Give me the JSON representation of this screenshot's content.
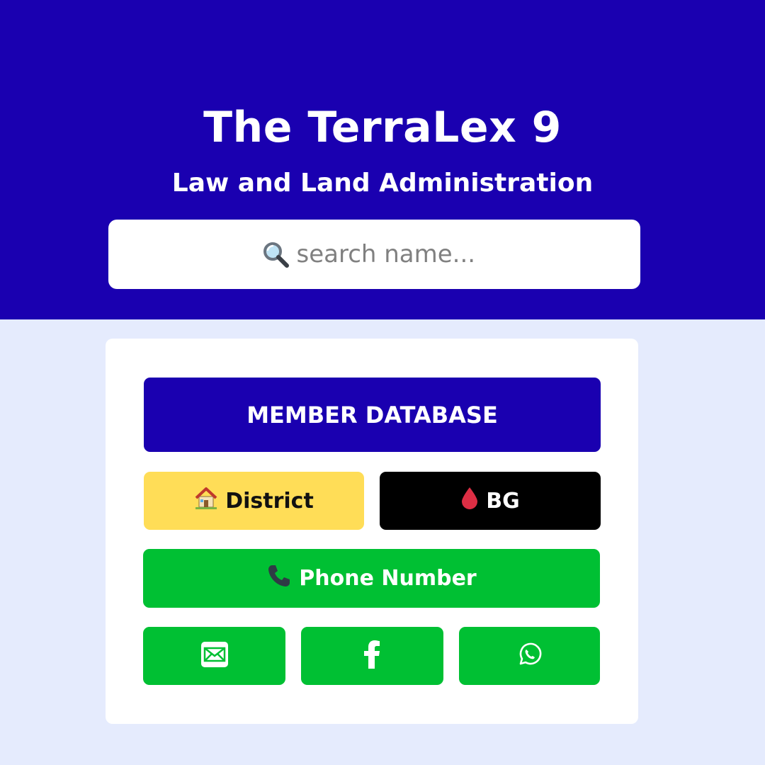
{
  "header": {
    "title": "The TerraLex 9",
    "subtitle": "Law and Land Administration"
  },
  "search": {
    "placeholder": "search name...",
    "icon": "search-icon"
  },
  "card": {
    "member_database_label": "MEMBER DATABASE",
    "district_label": "District",
    "district_icon": "house-icon",
    "bg_label": "BG",
    "bg_icon": "blood-drop-icon",
    "phone_label": "Phone Number",
    "phone_icon": "telephone-icon",
    "social": [
      {
        "icon": "email-icon"
      },
      {
        "icon": "facebook-icon"
      },
      {
        "icon": "whatsapp-icon"
      }
    ]
  },
  "colors": {
    "header_bg": "#1a00b0",
    "page_bg": "#e5ebfd",
    "district_bg": "#ffdd57",
    "bg_button": "#000000",
    "green": "#00c033"
  }
}
